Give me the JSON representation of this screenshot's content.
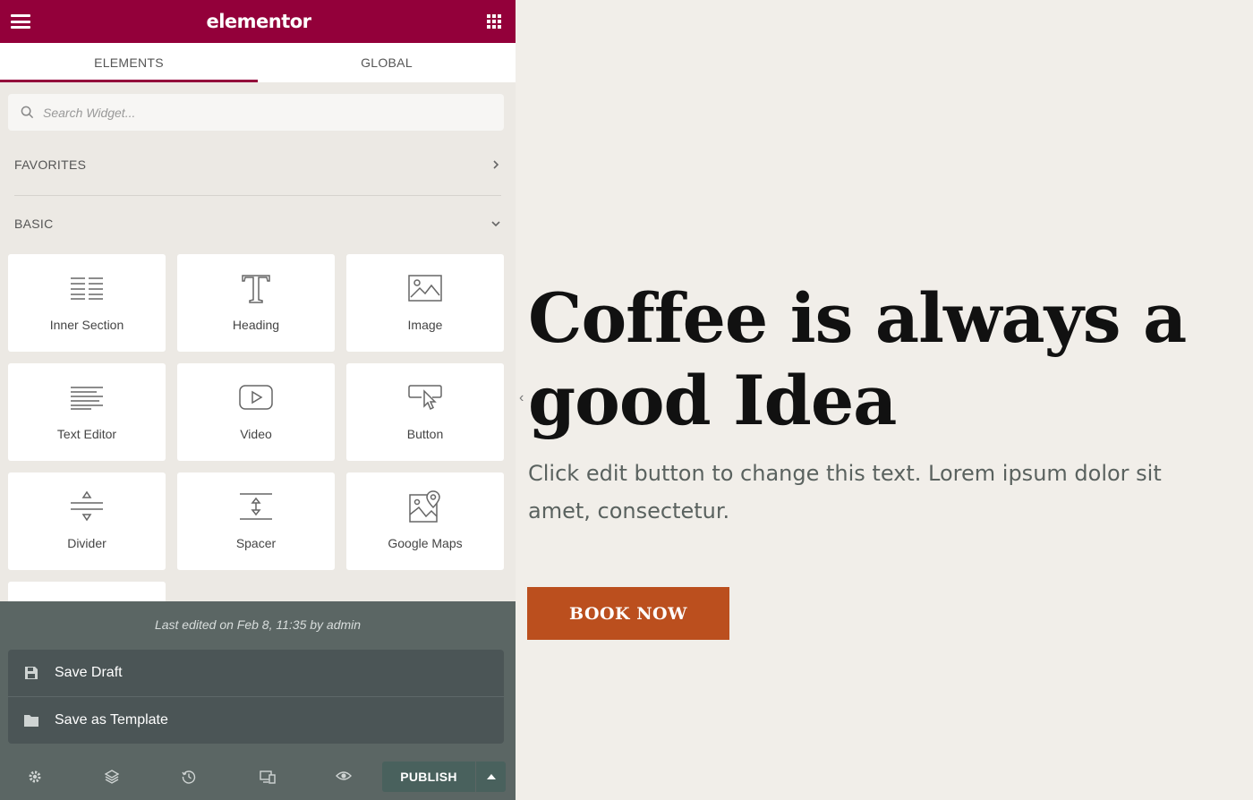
{
  "header": {
    "logo": "elementor"
  },
  "tabs": [
    {
      "label": "ELEMENTS",
      "active": true
    },
    {
      "label": "GLOBAL",
      "active": false
    }
  ],
  "search": {
    "placeholder": "Search Widget..."
  },
  "sections": {
    "favorites": "FAVORITES",
    "basic": "BASIC"
  },
  "widgets": [
    {
      "label": "Inner Section",
      "icon": "inner-section-icon"
    },
    {
      "label": "Heading",
      "icon": "heading-icon"
    },
    {
      "label": "Image",
      "icon": "image-icon"
    },
    {
      "label": "Text Editor",
      "icon": "text-editor-icon"
    },
    {
      "label": "Video",
      "icon": "video-icon"
    },
    {
      "label": "Button",
      "icon": "button-icon"
    },
    {
      "label": "Divider",
      "icon": "divider-icon"
    },
    {
      "label": "Spacer",
      "icon": "spacer-icon"
    },
    {
      "label": "Google Maps",
      "icon": "google-maps-icon"
    }
  ],
  "footer": {
    "last_edited": "Last edited on Feb 8, 11:35 by admin",
    "save_draft": "Save Draft",
    "save_template": "Save as Template",
    "publish": "PUBLISH"
  },
  "canvas": {
    "headline": "Coffee is always a good Idea",
    "body": "Click edit button to change this text. Lorem ipsum dolor sit amet, consectetur.",
    "button": "BOOK NOW"
  },
  "colors": {
    "brand": "#93003a",
    "panel_bg": "#ece9e4",
    "canvas_bg": "#f1eee9",
    "footer_bg": "#5b6664",
    "publish_bg": "#49615d",
    "book_button": "#bb4f1e"
  }
}
